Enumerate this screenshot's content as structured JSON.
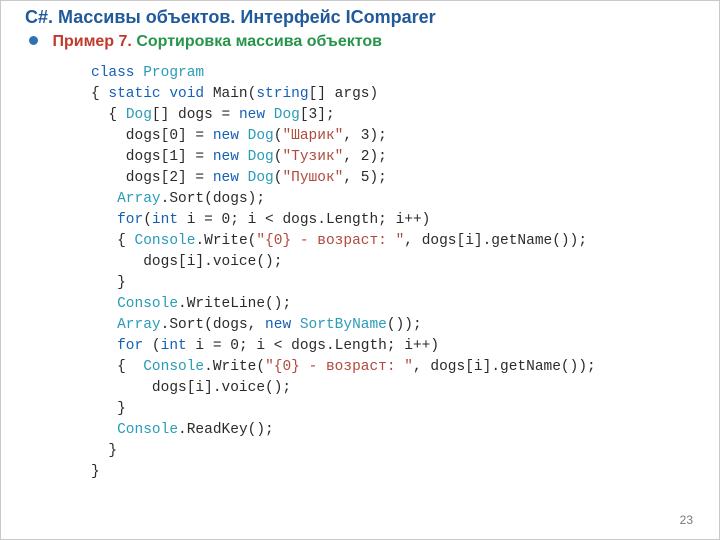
{
  "title": "C#. Массивы объектов. Интерфейс IComparer",
  "subtitle": {
    "example_label": "Пример 7.",
    "text": "Сортировка массива объектов"
  },
  "code": {
    "lines": [
      [
        {
          "t": "class ",
          "c": "kw"
        },
        {
          "t": "Program",
          "c": "typ"
        }
      ],
      [
        {
          "t": "{ ",
          "c": ""
        },
        {
          "t": "static void ",
          "c": "kw"
        },
        {
          "t": "Main(",
          "c": ""
        },
        {
          "t": "string",
          "c": "kw"
        },
        {
          "t": "[] args)",
          "c": ""
        }
      ],
      [
        {
          "t": "  { ",
          "c": ""
        },
        {
          "t": "Dog",
          "c": "typ"
        },
        {
          "t": "[] dogs = ",
          "c": ""
        },
        {
          "t": "new ",
          "c": "kw"
        },
        {
          "t": "Dog",
          "c": "typ"
        },
        {
          "t": "[3];",
          "c": ""
        }
      ],
      [
        {
          "t": "    dogs[0] = ",
          "c": ""
        },
        {
          "t": "new ",
          "c": "kw"
        },
        {
          "t": "Dog",
          "c": "typ"
        },
        {
          "t": "(",
          "c": ""
        },
        {
          "t": "\"Шарик\"",
          "c": "str"
        },
        {
          "t": ", 3);",
          "c": ""
        }
      ],
      [
        {
          "t": "    dogs[1] = ",
          "c": ""
        },
        {
          "t": "new ",
          "c": "kw"
        },
        {
          "t": "Dog",
          "c": "typ"
        },
        {
          "t": "(",
          "c": ""
        },
        {
          "t": "\"Тузик\"",
          "c": "str"
        },
        {
          "t": ", 2);",
          "c": ""
        }
      ],
      [
        {
          "t": "    dogs[2] = ",
          "c": ""
        },
        {
          "t": "new ",
          "c": "kw"
        },
        {
          "t": "Dog",
          "c": "typ"
        },
        {
          "t": "(",
          "c": ""
        },
        {
          "t": "\"Пушок\"",
          "c": "str"
        },
        {
          "t": ", 5);",
          "c": ""
        }
      ],
      [
        {
          "t": "   ",
          "c": ""
        },
        {
          "t": "Array",
          "c": "typ"
        },
        {
          "t": ".Sort(dogs);",
          "c": ""
        }
      ],
      [
        {
          "t": "   ",
          "c": ""
        },
        {
          "t": "for",
          "c": "kw"
        },
        {
          "t": "(",
          "c": ""
        },
        {
          "t": "int",
          "c": "kw"
        },
        {
          "t": " i = 0; i < dogs.Length; i++)",
          "c": ""
        }
      ],
      [
        {
          "t": "   { ",
          "c": ""
        },
        {
          "t": "Console",
          "c": "typ"
        },
        {
          "t": ".Write(",
          "c": ""
        },
        {
          "t": "\"{0} - возраст: \"",
          "c": "str"
        },
        {
          "t": ", dogs[i].getName());",
          "c": ""
        }
      ],
      [
        {
          "t": "      dogs[i].voice();",
          "c": ""
        }
      ],
      [
        {
          "t": "   }",
          "c": ""
        }
      ],
      [
        {
          "t": "   ",
          "c": ""
        },
        {
          "t": "Console",
          "c": "typ"
        },
        {
          "t": ".WriteLine();",
          "c": ""
        }
      ],
      [
        {
          "t": "   ",
          "c": ""
        },
        {
          "t": "Array",
          "c": "typ"
        },
        {
          "t": ".Sort(dogs, ",
          "c": ""
        },
        {
          "t": "new ",
          "c": "kw"
        },
        {
          "t": "SortByName",
          "c": "typ"
        },
        {
          "t": "());",
          "c": ""
        }
      ],
      [
        {
          "t": "   ",
          "c": ""
        },
        {
          "t": "for ",
          "c": "kw"
        },
        {
          "t": "(",
          "c": ""
        },
        {
          "t": "int",
          "c": "kw"
        },
        {
          "t": " i = 0; i < dogs.Length; i++)",
          "c": ""
        }
      ],
      [
        {
          "t": "   {  ",
          "c": ""
        },
        {
          "t": "Console",
          "c": "typ"
        },
        {
          "t": ".Write(",
          "c": ""
        },
        {
          "t": "\"{0} - возраст: \"",
          "c": "str"
        },
        {
          "t": ", dogs[i].getName());",
          "c": ""
        }
      ],
      [
        {
          "t": "       dogs[i].voice();",
          "c": ""
        }
      ],
      [
        {
          "t": "   }",
          "c": ""
        }
      ],
      [
        {
          "t": "   ",
          "c": ""
        },
        {
          "t": "Console",
          "c": "typ"
        },
        {
          "t": ".ReadKey();",
          "c": ""
        }
      ],
      [
        {
          "t": "  }",
          "c": ""
        }
      ],
      [
        {
          "t": "}",
          "c": ""
        }
      ]
    ]
  },
  "page_number": "23"
}
